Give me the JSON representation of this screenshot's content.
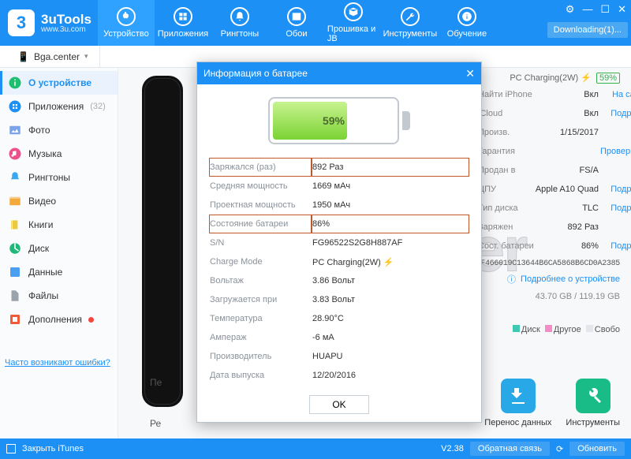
{
  "app": {
    "title": "3uTools",
    "url": "www.3u.com"
  },
  "downloading": "Downloading(1)...",
  "nav": [
    {
      "label": "Устройство",
      "icon": "apple"
    },
    {
      "label": "Приложения",
      "icon": "apps"
    },
    {
      "label": "Рингтоны",
      "icon": "bell"
    },
    {
      "label": "Обои",
      "icon": "picture"
    },
    {
      "label": "Прошивка и JB",
      "icon": "box"
    },
    {
      "label": "Инструменты",
      "icon": "wrench"
    },
    {
      "label": "Обучение",
      "icon": "info"
    }
  ],
  "tab": "Bga.center",
  "sidebar": [
    {
      "label": "О устройстве",
      "icon": "info",
      "color": "#1ec06f"
    },
    {
      "label": "Приложения",
      "suffix": "(32)",
      "icon": "apps",
      "color": "#1c90f4",
      "dot": true
    },
    {
      "label": "Фото",
      "icon": "photo",
      "color": "#7aa3e8"
    },
    {
      "label": "Музыка",
      "icon": "music",
      "color": "#ef4f8a"
    },
    {
      "label": "Рингтоны",
      "icon": "bell",
      "color": "#3aa7f0"
    },
    {
      "label": "Видео",
      "icon": "video",
      "color": "#f4a93d"
    },
    {
      "label": "Книги",
      "icon": "book",
      "color": "#ecca3d"
    },
    {
      "label": "Диск",
      "icon": "disk",
      "color": "#1fb879"
    },
    {
      "label": "Данные",
      "icon": "data",
      "color": "#4b9ff3"
    },
    {
      "label": "Файлы",
      "icon": "files",
      "color": "#9aa3ac"
    },
    {
      "label": "Дополнения",
      "icon": "addons",
      "color": "#ef5b36",
      "dot": true
    }
  ],
  "sidefoot": "Часто возникают ошибки?",
  "pe_label": "Пе",
  "pe2_label": "Ре",
  "charging": {
    "label": "PC Charging(2W)",
    "pct": "59%"
  },
  "info": [
    {
      "k": "Найти iPhone",
      "v": "Вкл",
      "v_on": true,
      "link": "На сайт"
    },
    {
      "k": "iCloud",
      "v": "Вкл",
      "v_on": true,
      "link": "Подроб."
    },
    {
      "k": "Произв.",
      "v": "1/15/2017"
    },
    {
      "k": "Гарантия",
      "link": "Проверить"
    },
    {
      "k": "Продан в",
      "v": "FS/A"
    },
    {
      "k": "ЦПУ",
      "v": "Apple A10 Quad",
      "link": "Подроб."
    },
    {
      "k": "Тип диска",
      "v": "TLC",
      "link": "Подроб."
    },
    {
      "k": "Заряжен",
      "v": "892 Раз"
    },
    {
      "k": "Сост. батареи",
      "v": "86%",
      "link": "Подроб."
    }
  ],
  "udid": "F466019C13644B6CA5868B6CD0A2385",
  "detailsLink": "Подробнее о устройстве",
  "storage": "43.70 GB / 119.19 GB",
  "legend": [
    {
      "label": "Диск",
      "color": "#3fc9b0"
    },
    {
      "label": "Другое",
      "color": "#f28dc7"
    },
    {
      "label": "Свобо",
      "color": "#e3e7ec"
    }
  ],
  "bigbtn1": "Перенос данных",
  "bigbtn2": "Инструменты",
  "modal": {
    "title": "Информация о батарее",
    "pct": "59%",
    "rows": [
      {
        "k": "Заряжался (раз)",
        "v": "892 Раз",
        "hl": true
      },
      {
        "k": "Средняя мощность",
        "v": "1669 мАч"
      },
      {
        "k": "Проектная мощность",
        "v": "1950 мАч"
      },
      {
        "k": "Состояние батареи",
        "v": "86%",
        "hl": true
      },
      {
        "k": "S/N",
        "v": "FG96522S2G8H887AF"
      },
      {
        "k": "Charge Mode",
        "v": "PC Charging(2W)",
        "bolt": true
      },
      {
        "k": "Вольтаж",
        "v": "3.86 Вольт"
      },
      {
        "k": "Загружается при",
        "v": "3.83 Вольт"
      },
      {
        "k": "Температура",
        "v": "28.90°C"
      },
      {
        "k": "Ампераж",
        "v": "-6 мА"
      },
      {
        "k": "Производитель",
        "v": "HUAPU"
      },
      {
        "k": "Дата выпуска",
        "v": "12/20/2016"
      }
    ],
    "ok": "OK"
  },
  "footer": {
    "itunes": "Закрыть iTunes",
    "ver": "V2.38",
    "feedback": "Обратная связь",
    "refresh": "Обновить"
  },
  "watermark": "bga.center"
}
